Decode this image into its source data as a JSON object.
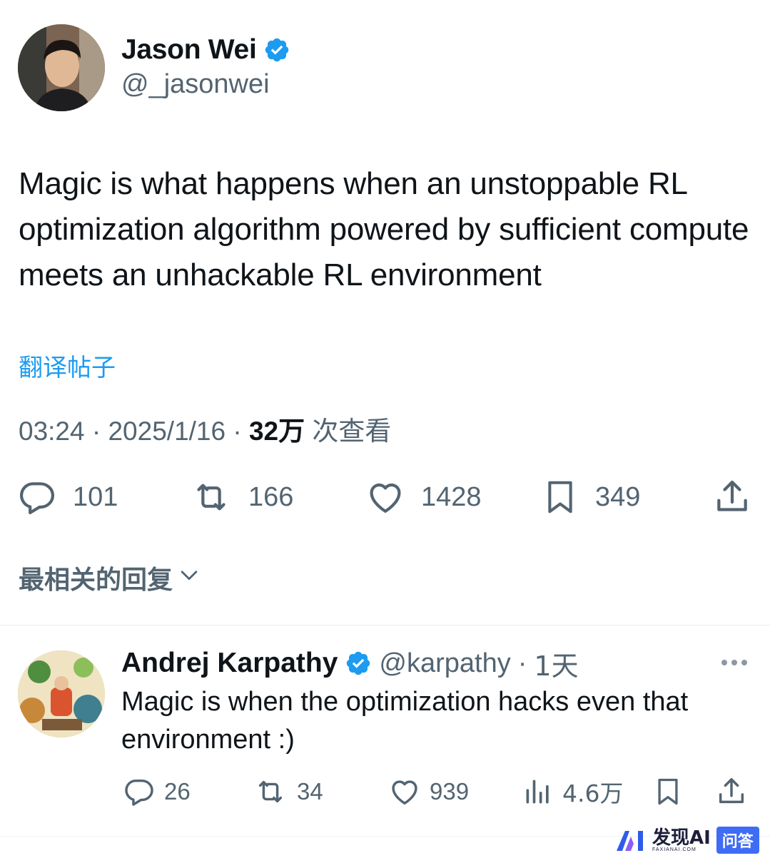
{
  "tweet": {
    "author_name": "Jason Wei",
    "author_handle": "@_jasonwei",
    "text": "Magic is what happens when an unstoppable RL optimization algorithm powered by sufficient compute meets an unhackable RL environment",
    "translate_label": "翻译帖子",
    "time": "03:24",
    "date": "2025/1/16",
    "views_count": "32万",
    "views_label": "次查看",
    "separator": " · ",
    "actions": {
      "replies": "101",
      "retweets": "166",
      "likes": "1428",
      "bookmarks": "349"
    }
  },
  "replies_sort": {
    "label": "最相关的回复"
  },
  "reply": {
    "author_name": "Andrej Karpathy",
    "author_handle": "@karpathy",
    "age": "1天",
    "text": "Magic is when the optimization hacks even that environment :)",
    "actions": {
      "replies": "26",
      "retweets": "34",
      "likes": "939",
      "views": "4.6万"
    }
  },
  "watermark": {
    "name": "发现AI",
    "sub": "FAXIANAI.COM",
    "badge": "问答"
  },
  "colors": {
    "verified": "#1d9bf0",
    "link": "#1d9bf0",
    "secondary_text": "#536471",
    "primary_text": "#0f1419"
  },
  "icons": [
    "verified-badge-icon",
    "reply-icon",
    "retweet-icon",
    "like-icon",
    "bookmark-icon",
    "share-icon",
    "views-icon",
    "more-icon",
    "chevron-down-icon"
  ]
}
